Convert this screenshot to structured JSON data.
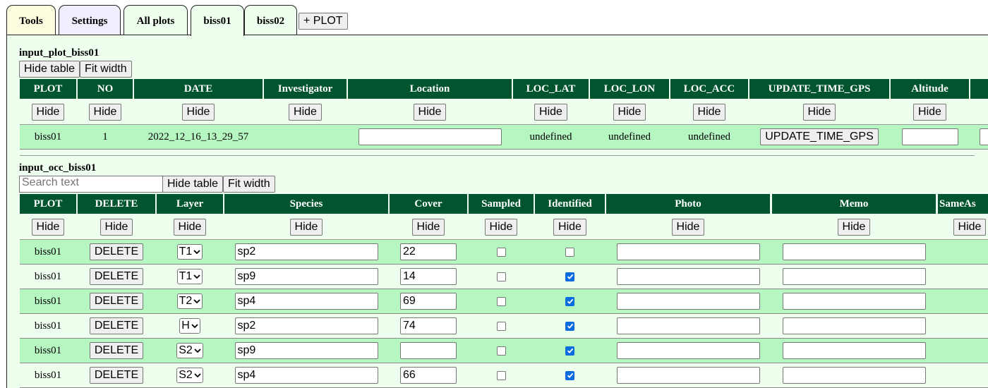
{
  "tabs": [
    {
      "label": "Tools"
    },
    {
      "label": "Settings"
    },
    {
      "label": "All plots"
    },
    {
      "label": "biss01"
    },
    {
      "label": "biss02"
    }
  ],
  "add_plot_label": "+ PLOT",
  "plot_section": {
    "title": "input_plot_biss01",
    "hide_table_label": "Hide table",
    "fit_width_label": "Fit width",
    "headers": [
      "PLOT",
      "NO",
      "DATE",
      "Investigator",
      "Location",
      "LOC_LAT",
      "LOC_LON",
      "LOC_ACC",
      "UPDATE_TIME_GPS",
      "Altitude"
    ],
    "hide_label": "Hide",
    "row": {
      "plot": "biss01",
      "no": "1",
      "date": "2022_12_16_13_29_57",
      "investigator": "",
      "location": "",
      "loc_lat": "undefined",
      "loc_lon": "undefined",
      "loc_acc": "undefined",
      "update_button": "UPDATE_TIME_GPS",
      "altitude": ""
    }
  },
  "occ_section": {
    "title": "input_occ_biss01",
    "search_placeholder": "Search text",
    "hide_table_label": "Hide table",
    "fit_width_label": "Fit width",
    "headers": [
      "PLOT",
      "DELETE",
      "Layer",
      "Species",
      "Cover",
      "Sampled",
      "Identified",
      "Photo",
      "Memo",
      "SameAs"
    ],
    "hide_label": "Hide",
    "delete_label": "DELETE",
    "rows": [
      {
        "plot": "biss01",
        "layer": "T1",
        "species": "sp2",
        "cover": "22",
        "sampled": false,
        "identified": false,
        "photo": "",
        "memo": ""
      },
      {
        "plot": "biss01",
        "layer": "T1",
        "species": "sp9",
        "cover": "14",
        "sampled": false,
        "identified": true,
        "photo": "",
        "memo": ""
      },
      {
        "plot": "biss01",
        "layer": "T2",
        "species": "sp4",
        "cover": "69",
        "sampled": false,
        "identified": true,
        "photo": "",
        "memo": ""
      },
      {
        "plot": "biss01",
        "layer": "H",
        "species": "sp2",
        "cover": "74",
        "sampled": false,
        "identified": true,
        "photo": "",
        "memo": ""
      },
      {
        "plot": "biss01",
        "layer": "S2",
        "species": "sp9",
        "cover": "",
        "sampled": false,
        "identified": true,
        "photo": "",
        "memo": ""
      },
      {
        "plot": "biss01",
        "layer": "S2",
        "species": "sp4",
        "cover": "66",
        "sampled": false,
        "identified": true,
        "photo": "",
        "memo": ""
      }
    ]
  },
  "colors": {
    "header_bg": "#00542e",
    "panel_bg": "#eeffee",
    "row_green": "#b6f7c1",
    "checkbox_on": "#0b6ce0"
  }
}
